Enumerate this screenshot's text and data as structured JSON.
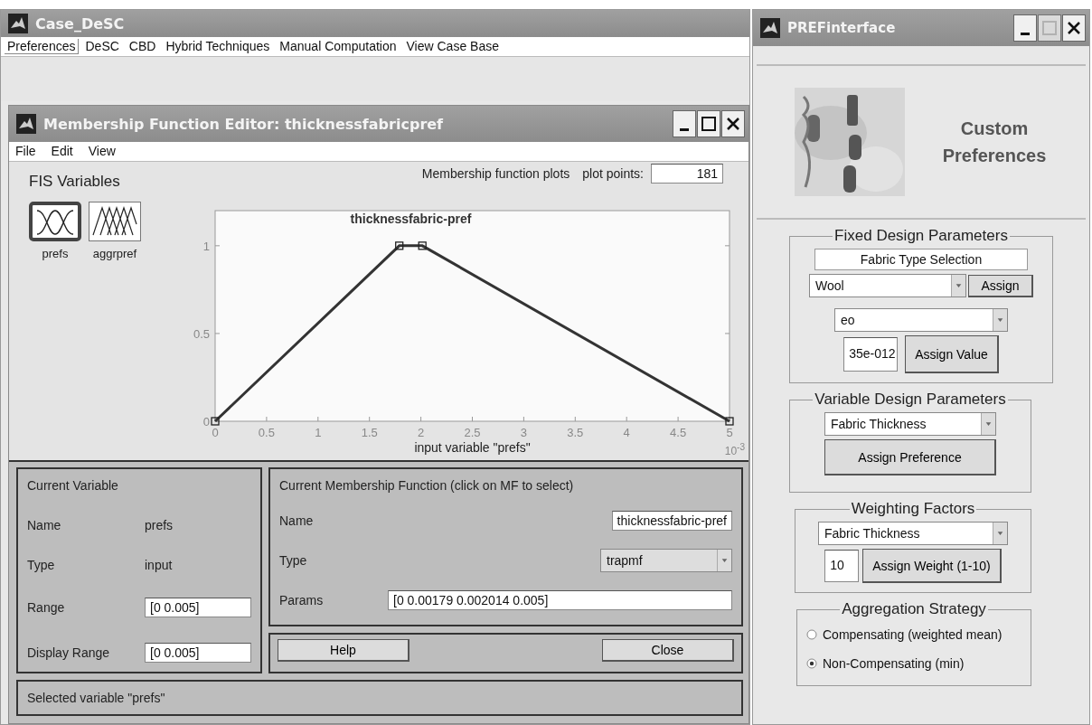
{
  "main_window": {
    "title": "Case_DeSC",
    "menu": [
      {
        "label": "Preferences",
        "selected": true
      },
      {
        "label": "DeSC",
        "selected": false
      },
      {
        "label": "CBD",
        "selected": false
      },
      {
        "label": "Hybrid Techniques",
        "selected": false
      },
      {
        "label": "Manual Computation",
        "selected": false
      },
      {
        "label": "View Case Base",
        "selected": false
      }
    ]
  },
  "mf_editor": {
    "title": "Membership Function Editor: thicknessfabricpref",
    "controls": [
      {
        "kind": "minimize",
        "disabled": false
      },
      {
        "kind": "maximize",
        "disabled": false
      },
      {
        "kind": "close",
        "disabled": false
      }
    ],
    "menu": [
      "File",
      "Edit",
      "View"
    ],
    "fis_variables": {
      "label": "FIS Variables",
      "items": [
        {
          "label": "prefs",
          "kind": "input",
          "selected": true
        },
        {
          "label": "aggrpref",
          "kind": "output",
          "selected": false
        }
      ]
    },
    "plots_label": "Membership function plots",
    "plot_points": {
      "label": "plot points:",
      "value": "181"
    },
    "chart_data": {
      "type": "line",
      "xlabel": "input variable \"prefs\"",
      "x": [
        0,
        1.79,
        2.014,
        5
      ],
      "series": [
        {
          "name": "thicknessfabric-pref",
          "color": "#333333",
          "marker": "square",
          "values": [
            0,
            1,
            1,
            0
          ]
        }
      ],
      "xlim": [
        0,
        5
      ],
      "ylim": [
        0,
        1.2
      ],
      "xticks": [
        0,
        0.5,
        1,
        1.5,
        2,
        2.5,
        3,
        3.5,
        4,
        4.5,
        5
      ],
      "yticks": [
        0,
        0.5,
        1
      ],
      "annotations": [
        {
          "text": "10$^{-3}$"
        }
      ]
    },
    "current_variable": {
      "title": "Current Variable",
      "name_label": "Name",
      "name": "prefs",
      "type_label": "Type",
      "type": "input",
      "range_label": "Range",
      "range": "[0 0.005]",
      "display_range_label": "Display Range",
      "display_range": "[0 0.005]"
    },
    "current_mf": {
      "title": "Current Membership Function (click on MF to select)",
      "name_label": "Name",
      "name": "thicknessfabric-pref",
      "type_label": "Type",
      "type": "trapmf",
      "params_label": "Params",
      "params": "[0 0.00179 0.002014 0.005]"
    },
    "buttons": [
      "Help",
      "Close"
    ],
    "status": "Selected variable \"prefs\""
  },
  "pref_window": {
    "title": "PREFinterface",
    "controls": [
      {
        "kind": "minimize",
        "disabled": false
      },
      {
        "kind": "maximize",
        "disabled": true
      },
      {
        "kind": "close",
        "disabled": false
      }
    ],
    "heading": "Custom Preferences",
    "fixed": {
      "title": "Fixed Design Parameters",
      "label": "Fabric Type Selection",
      "fabric_type": "Wool",
      "assign": "Assign",
      "property": "eo",
      "value": "35e-012",
      "assign_value": "Assign Value"
    },
    "variable": {
      "title": "Variable Design Parameters",
      "parameter": "Fabric Thickness",
      "assign": "Assign Preference"
    },
    "weighting": {
      "title": "Weighting Factors",
      "parameter": "Fabric Thickness",
      "weight": "10",
      "assign": "Assign Weight (1-10)"
    },
    "aggregation": {
      "title": "Aggregation Strategy",
      "options": [
        {
          "label": "Compensating (weighted mean)",
          "selected": false
        },
        {
          "label": "Non-Compensating (min)",
          "selected": true
        }
      ]
    }
  }
}
